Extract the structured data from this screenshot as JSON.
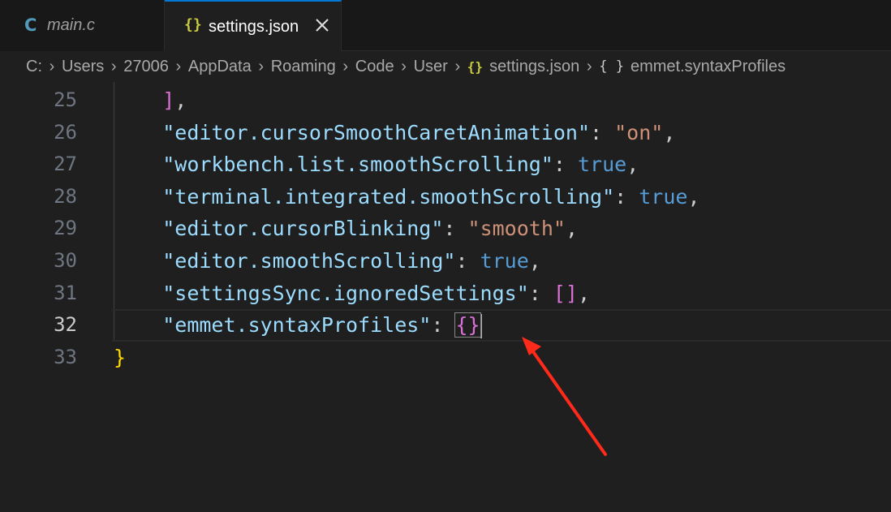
{
  "tabs": [
    {
      "label": "main.c",
      "icon": "c-file-icon",
      "active": false
    },
    {
      "label": "settings.json",
      "icon": "json-file-icon",
      "active": true
    }
  ],
  "icons": {
    "c_glyph": "C",
    "json_glyph": "{}",
    "object_glyph": "{ }"
  },
  "breadcrumb": [
    "C:",
    "Users",
    "27006",
    "AppData",
    "Roaming",
    "Code",
    "User",
    "settings.json",
    "emmet.syntaxProfiles"
  ],
  "editor": {
    "lines": [
      {
        "num": "25",
        "tokens": [
          {
            "t": "    ",
            "c": "punc"
          },
          {
            "t": "]",
            "c": "brk2"
          },
          {
            "t": ",",
            "c": "punc"
          }
        ]
      },
      {
        "num": "26",
        "tokens": [
          {
            "t": "    ",
            "c": "punc"
          },
          {
            "t": "\"editor.cursorSmoothCaretAnimation\"",
            "c": "key"
          },
          {
            "t": ": ",
            "c": "punc"
          },
          {
            "t": "\"on\"",
            "c": "str"
          },
          {
            "t": ",",
            "c": "punc"
          }
        ]
      },
      {
        "num": "27",
        "tokens": [
          {
            "t": "    ",
            "c": "punc"
          },
          {
            "t": "\"workbench.list.smoothScrolling\"",
            "c": "key"
          },
          {
            "t": ": ",
            "c": "punc"
          },
          {
            "t": "true",
            "c": "kw"
          },
          {
            "t": ",",
            "c": "punc"
          }
        ]
      },
      {
        "num": "28",
        "tokens": [
          {
            "t": "    ",
            "c": "punc"
          },
          {
            "t": "\"terminal.integrated.smoothScrolling\"",
            "c": "key"
          },
          {
            "t": ": ",
            "c": "punc"
          },
          {
            "t": "true",
            "c": "kw"
          },
          {
            "t": ",",
            "c": "punc"
          }
        ]
      },
      {
        "num": "29",
        "tokens": [
          {
            "t": "    ",
            "c": "punc"
          },
          {
            "t": "\"editor.cursorBlinking\"",
            "c": "key"
          },
          {
            "t": ": ",
            "c": "punc"
          },
          {
            "t": "\"smooth\"",
            "c": "str"
          },
          {
            "t": ",",
            "c": "punc"
          }
        ]
      },
      {
        "num": "30",
        "tokens": [
          {
            "t": "    ",
            "c": "punc"
          },
          {
            "t": "\"editor.smoothScrolling\"",
            "c": "key"
          },
          {
            "t": ": ",
            "c": "punc"
          },
          {
            "t": "true",
            "c": "kw"
          },
          {
            "t": ",",
            "c": "punc"
          }
        ]
      },
      {
        "num": "31",
        "tokens": [
          {
            "t": "    ",
            "c": "punc"
          },
          {
            "t": "\"settingsSync.ignoredSettings\"",
            "c": "key"
          },
          {
            "t": ": ",
            "c": "punc"
          },
          {
            "t": "[]",
            "c": "brk2"
          },
          {
            "t": ",",
            "c": "punc"
          }
        ]
      },
      {
        "num": "32",
        "current": true,
        "tokens": [
          {
            "t": "    ",
            "c": "punc"
          },
          {
            "t": "\"emmet.syntaxProfiles\"",
            "c": "key"
          },
          {
            "t": ": ",
            "c": "punc"
          },
          {
            "t": "{}",
            "c": "brk2 cursor-box"
          }
        ]
      },
      {
        "num": "33",
        "tokens": [
          {
            "t": "}",
            "c": "brk1"
          }
        ]
      }
    ]
  },
  "colors": {
    "background": "#1f1f1f",
    "tab_bar": "#181818",
    "active_tab_border": "#0078d4",
    "key": "#9cdcfe",
    "string": "#ce9178",
    "keyword": "#569cd6",
    "bracket_level1": "#ffd700",
    "bracket_level2": "#da70d6",
    "annotation_arrow": "#ff2a1a"
  }
}
